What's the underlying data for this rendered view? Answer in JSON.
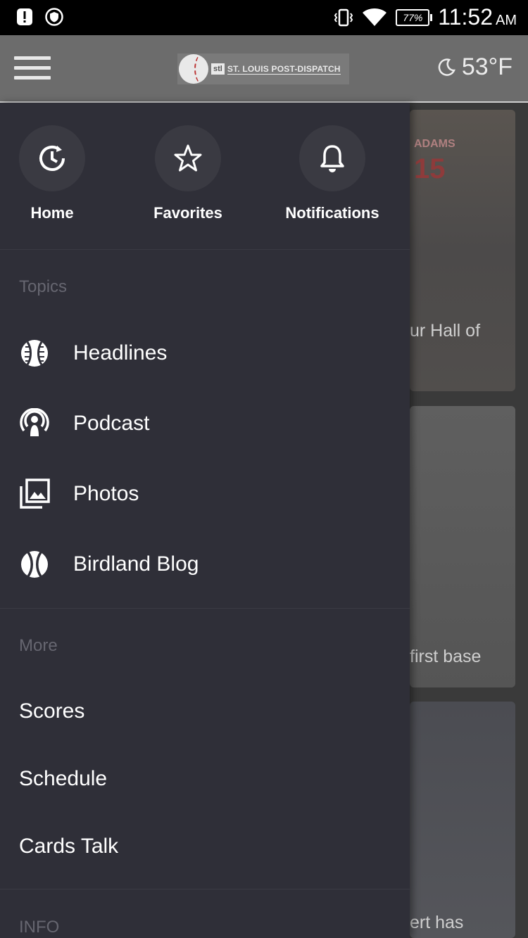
{
  "status_bar": {
    "time": "11:52",
    "ampm": "AM",
    "battery": "77%",
    "icons": [
      "alert-icon",
      "vpn-shield-icon",
      "vibrate-icon",
      "wifi-icon",
      "battery-icon"
    ]
  },
  "app_bar": {
    "menu_icon": "hamburger-icon",
    "logo_badge": "stl",
    "logo_text": "ST. LOUIS POST-DISPATCH",
    "weather_icon": "moon-icon",
    "temperature": "53°F"
  },
  "drawer": {
    "quick_actions": [
      {
        "label": "Home",
        "icon": "home-clock-icon"
      },
      {
        "label": "Favorites",
        "icon": "star-icon"
      },
      {
        "label": "Notifications",
        "icon": "bell-icon"
      }
    ],
    "topics_label": "Topics",
    "topics": [
      {
        "label": "Headlines",
        "icon": "baseball-icon"
      },
      {
        "label": "Podcast",
        "icon": "podcast-icon"
      },
      {
        "label": "Photos",
        "icon": "photos-icon"
      },
      {
        "label": "Birdland Blog",
        "icon": "baseball-icon"
      }
    ],
    "more_label": "More",
    "more_items": [
      "Scores",
      "Schedule",
      "Cards Talk"
    ],
    "info_label": "INFO"
  },
  "background": {
    "card1_text": "ur Hall of",
    "card1_jersey_name": "ADAMS",
    "card1_jersey_number": "15",
    "card2_text": "first base",
    "card3_text": "ert has"
  },
  "colors": {
    "drawer_bg": "#2f2f38",
    "app_bar_bg": "#6c6c6c",
    "section_label": "#666670"
  }
}
